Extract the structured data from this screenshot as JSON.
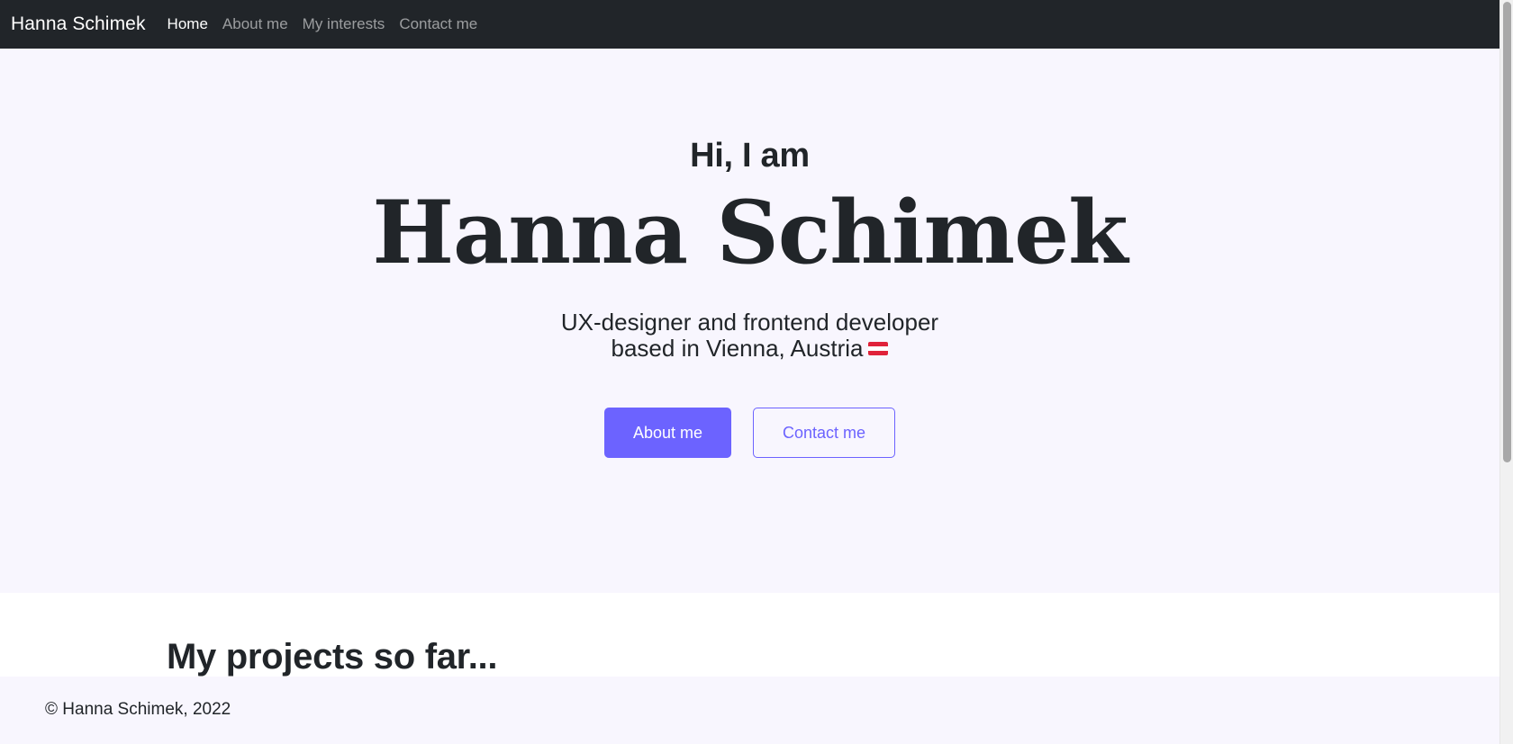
{
  "navbar": {
    "brand": "Hanna Schimek",
    "links": [
      {
        "label": "Home",
        "active": true
      },
      {
        "label": "About me",
        "active": false
      },
      {
        "label": "My interests",
        "active": false
      },
      {
        "label": "Contact me",
        "active": false
      }
    ]
  },
  "hero": {
    "greeting": "Hi, I am",
    "name": "Hanna Schimek",
    "tagline_line1": "UX-designer and frontend developer",
    "tagline_line2": "based in Vienna, Austria",
    "flag_icon": "austria-flag-icon",
    "buttons": {
      "primary": "About me",
      "secondary": "Contact me"
    }
  },
  "projects": {
    "title": "My projects so far..."
  },
  "footer": {
    "text": "© Hanna Schimek, 2022"
  },
  "colors": {
    "accent": "#6c63ff",
    "navbar_bg": "#212529",
    "hero_bg": "#f8f6fe",
    "text": "#212529"
  }
}
